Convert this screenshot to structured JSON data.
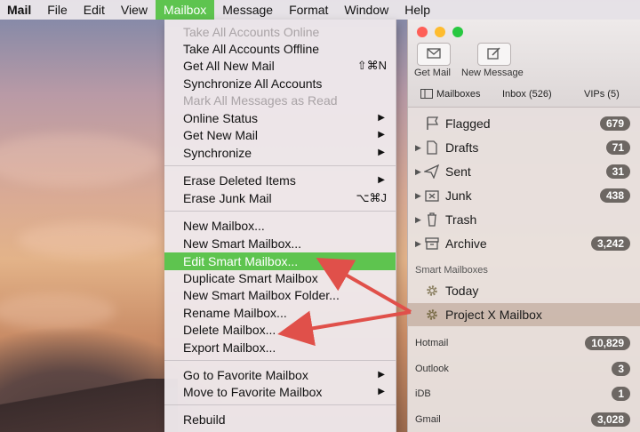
{
  "menubar": {
    "items": [
      "Mail",
      "File",
      "Edit",
      "View",
      "Mailbox",
      "Message",
      "Format",
      "Window",
      "Help"
    ],
    "active": "Mailbox"
  },
  "mailbox_menu": {
    "items": [
      {
        "label": "Take All Accounts Online",
        "state": "disabled"
      },
      {
        "label": "Take All Accounts Offline"
      },
      {
        "label": "Get All New Mail",
        "shortcut": "⇧⌘N"
      },
      {
        "label": "Synchronize All Accounts"
      },
      {
        "label": "Mark All Messages as Read",
        "state": "disabled"
      },
      {
        "label": "Online Status",
        "submenu": true
      },
      {
        "label": "Get New Mail",
        "submenu": true
      },
      {
        "label": "Synchronize",
        "submenu": true
      },
      {
        "label": "Erase Deleted Items",
        "submenu": true
      },
      {
        "label": "Erase Junk Mail",
        "shortcut": "⌥⌘J"
      },
      {
        "label": "New Mailbox..."
      },
      {
        "label": "New Smart Mailbox..."
      },
      {
        "label": "Edit Smart Mailbox...",
        "state": "highlighted"
      },
      {
        "label": "Duplicate Smart Mailbox"
      },
      {
        "label": "New Smart Mailbox Folder..."
      },
      {
        "label": "Rename Mailbox..."
      },
      {
        "label": "Delete Mailbox..."
      },
      {
        "label": "Export Mailbox..."
      },
      {
        "label": "Go to Favorite Mailbox",
        "submenu": true
      },
      {
        "label": "Move to Favorite Mailbox",
        "submenu": true
      },
      {
        "label": "Rebuild"
      }
    ],
    "submenu_glyph": "▶"
  },
  "window": {
    "traffic_lights": {
      "close": "#fe5f57",
      "minimize": "#febc2e",
      "zoom": "#28c840"
    },
    "toolbar": {
      "get_mail": "Get Mail",
      "new_message": "New Message"
    },
    "favorites": {
      "mailboxes": "Mailboxes",
      "inbox": "Inbox (526)",
      "vips": "VIPs (5)"
    },
    "mailboxes": [
      {
        "label": "Flagged",
        "count": "679",
        "icon": "flag-icon",
        "disclosure": false
      },
      {
        "label": "Drafts",
        "count": "71",
        "icon": "document-icon",
        "disclosure": true
      },
      {
        "label": "Sent",
        "count": "31",
        "icon": "paper-plane-icon",
        "disclosure": true
      },
      {
        "label": "Junk",
        "count": "438",
        "icon": "junk-box-icon",
        "disclosure": true
      },
      {
        "label": "Trash",
        "count": "",
        "icon": "trash-icon",
        "disclosure": true
      },
      {
        "label": "Archive",
        "count": "3,242",
        "icon": "archive-box-icon",
        "disclosure": true
      }
    ],
    "smart_header": "Smart Mailboxes",
    "smart_mailboxes": [
      {
        "label": "Today",
        "icon": "gear-icon"
      },
      {
        "label": "Project X Mailbox",
        "icon": "gear-icon",
        "selected": true
      }
    ],
    "accounts": [
      {
        "label": "Hotmail",
        "count": "10,829"
      },
      {
        "label": "Outlook",
        "count": "3"
      },
      {
        "label": "iDB",
        "count": "1"
      },
      {
        "label": "Gmail",
        "count": "3,028"
      }
    ],
    "disclosure_glyph": "▶"
  },
  "colors": {
    "accent": "#5ec44f",
    "annotation_arrow": "#e0504a",
    "badge": "#6d6763"
  }
}
